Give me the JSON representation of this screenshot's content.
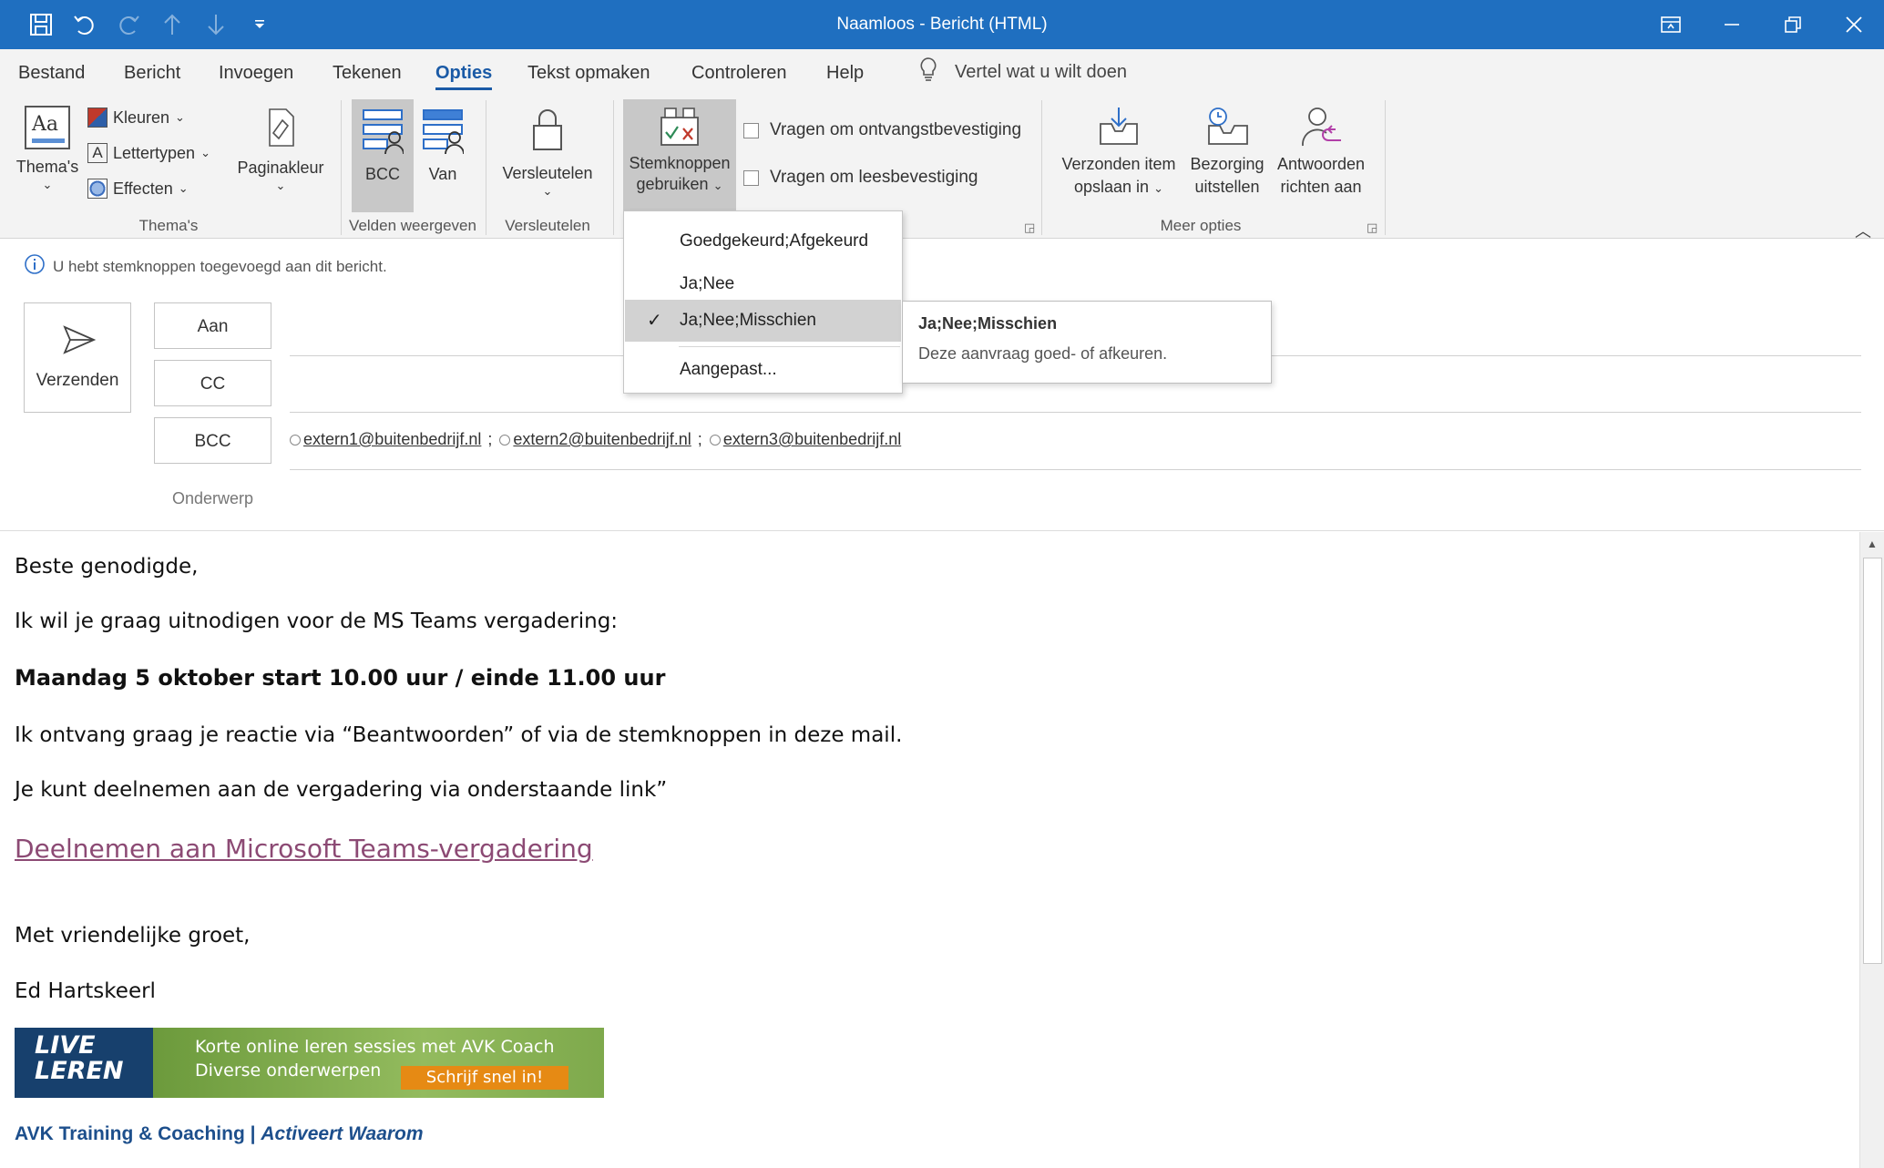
{
  "window": {
    "title": "Naamloos  -  Bericht (HTML)"
  },
  "tabs": [
    "Bestand",
    "Bericht",
    "Invoegen",
    "Tekenen",
    "Opties",
    "Tekst opmaken",
    "Controleren",
    "Help"
  ],
  "active_tab": "Opties",
  "tell_me": "Vertel wat u wilt doen",
  "ribbon": {
    "themes": {
      "themes_label": "Thema's",
      "colors_label": "Kleuren",
      "fonts_label": "Lettertypen",
      "effects_label": "Effecten",
      "page_color_label": "Paginakleur",
      "group_label": "Thema's"
    },
    "show_fields": {
      "bcc_label": "BCC",
      "from_label": "Van",
      "group_label": "Velden weergeven"
    },
    "encrypt": {
      "encrypt_label": "Versleutelen",
      "group_label": "Versleutelen"
    },
    "tracking": {
      "voting_line1": "Stemknoppen",
      "voting_line2": "gebruiken",
      "request_delivery": "Vragen om ontvangstbevestiging",
      "request_read": "Vragen om leesbevestiging"
    },
    "more": {
      "save_sent_line1": "Verzonden item",
      "save_sent_line2": "opslaan in",
      "delay_line1": "Bezorging",
      "delay_line2": "uitstellen",
      "reply_line1": "Antwoorden",
      "reply_line2": "richten aan",
      "group_label": "Meer opties"
    }
  },
  "info_message": "U hebt stemknoppen toegevoegd aan dit bericht.",
  "header": {
    "send_label": "Verzenden",
    "to_label": "Aan",
    "cc_label": "CC",
    "bcc_label": "BCC",
    "subject_label": "Onderwerp",
    "bcc_recipients": [
      "extern1@buitenbedrijf.nl",
      "extern2@buitenbedrijf.nl",
      "extern3@buitenbedrijf.nl"
    ],
    "separator": ";"
  },
  "body": {
    "greeting": "Beste genodigde,",
    "line1": "Ik wil je graag uitnodigen voor de MS Teams vergadering:",
    "date_line": "Maandag 5 oktober start 10.00 uur / einde 11.00 uur",
    "line2": "Ik ontvang graag je reactie via “Beantwoorden” of via de stemknoppen in deze mail.",
    "line3": "Je kunt deelnemen aan de vergadering via onderstaande link”",
    "teams_link": "Deelnemen aan Microsoft Teams-vergadering",
    "closing": "Met vriendelijke groet,",
    "sender": "Ed Hartskeerl",
    "banner": {
      "logo_line1": "LIVE",
      "logo_line2": "LEREN",
      "text_line1": "Korte online leren sessies met AVK Coach",
      "text_line2": "Diverse onderwerpen",
      "cta": "Schrijf snel in!"
    },
    "signature_company": "AVK Training & Coaching",
    "signature_separator": "|",
    "signature_slogan": "Activeert Waarom"
  },
  "dropdown": {
    "items": [
      "Goedgekeurd;Afgekeurd",
      "Ja;Nee",
      "Ja;Nee;Misschien"
    ],
    "selected": "Ja;Nee;Misschien",
    "custom_label": "Aangepast..."
  },
  "tooltip": {
    "title": "Ja;Nee;Misschien",
    "text": "Deze aanvraag goed- of afkeuren."
  },
  "colors": {
    "titlebar": "#1f6fc0",
    "accent": "#1a5aa6",
    "link": "#8c4a74",
    "signature": "#1d4f8c"
  }
}
